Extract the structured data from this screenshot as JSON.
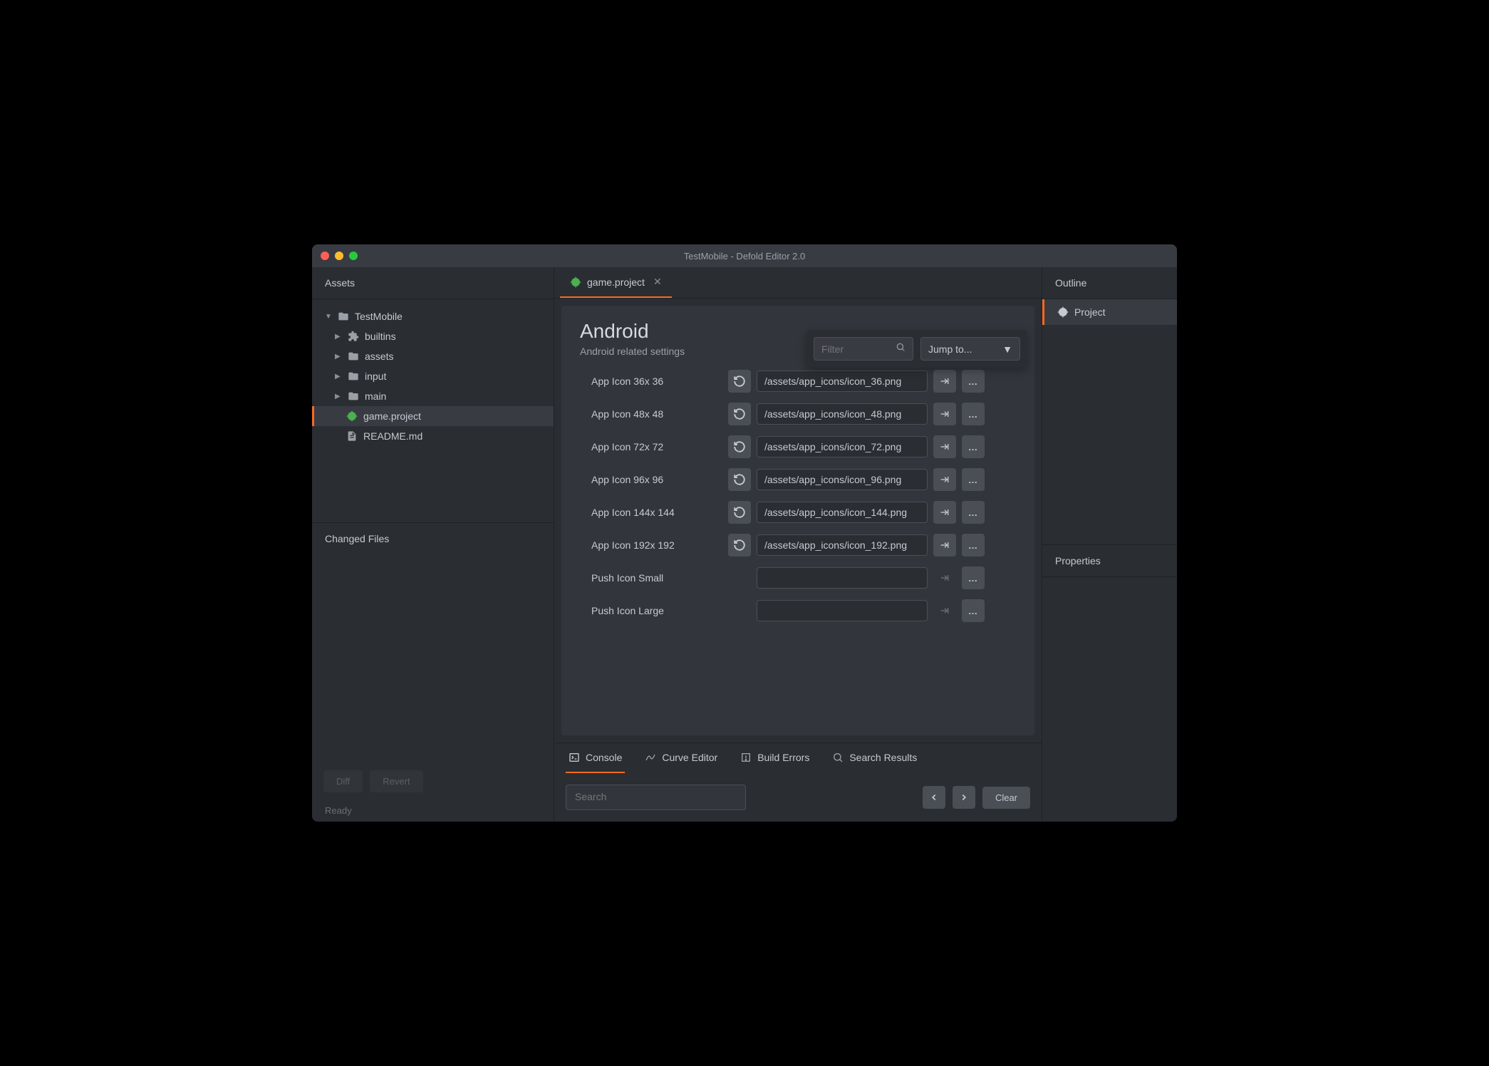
{
  "window": {
    "title": "TestMobile - Defold Editor 2.0"
  },
  "left": {
    "assets_label": "Assets",
    "tree": [
      {
        "label": "TestMobile",
        "icon": "folder",
        "expanded": true,
        "depth": 0
      },
      {
        "label": "builtins",
        "icon": "puzzle",
        "expanded": false,
        "depth": 1
      },
      {
        "label": "assets",
        "icon": "folder",
        "expanded": false,
        "depth": 1
      },
      {
        "label": "input",
        "icon": "folder",
        "expanded": false,
        "depth": 1
      },
      {
        "label": "main",
        "icon": "folder",
        "expanded": false,
        "depth": 1
      },
      {
        "label": "game.project",
        "icon": "gear-green",
        "depth": 2,
        "active": true
      },
      {
        "label": "README.md",
        "icon": "doc",
        "depth": 2
      }
    ],
    "changed_label": "Changed Files",
    "diff_label": "Diff",
    "revert_label": "Revert"
  },
  "status": "Ready",
  "center": {
    "tab": {
      "label": "game.project"
    },
    "section": {
      "title": "Android",
      "desc": "Android related settings"
    },
    "filter_placeholder": "Filter",
    "jump_label": "Jump to...",
    "props": [
      {
        "label": "App Icon 36x 36",
        "value": "/assets/app_icons/icon_36.png",
        "reset": true
      },
      {
        "label": "App Icon 48x 48",
        "value": "/assets/app_icons/icon_48.png",
        "reset": true
      },
      {
        "label": "App Icon 72x 72",
        "value": "/assets/app_icons/icon_72.png",
        "reset": true
      },
      {
        "label": "App Icon 96x 96",
        "value": "/assets/app_icons/icon_96.png",
        "reset": true
      },
      {
        "label": "App Icon 144x 144",
        "value": "/assets/app_icons/icon_144.png",
        "reset": true
      },
      {
        "label": "App Icon 192x 192",
        "value": "/assets/app_icons/icon_192.png",
        "reset": true
      },
      {
        "label": "Push Icon Small",
        "value": "",
        "reset": false
      },
      {
        "label": "Push Icon Large",
        "value": "",
        "reset": false
      }
    ],
    "bottom_tabs": {
      "console": "Console",
      "curve": "Curve Editor",
      "errors": "Build Errors",
      "search": "Search Results"
    },
    "console": {
      "search_placeholder": "Search",
      "clear_label": "Clear"
    }
  },
  "right": {
    "outline_label": "Outline",
    "outline_item": "Project",
    "properties_label": "Properties"
  }
}
